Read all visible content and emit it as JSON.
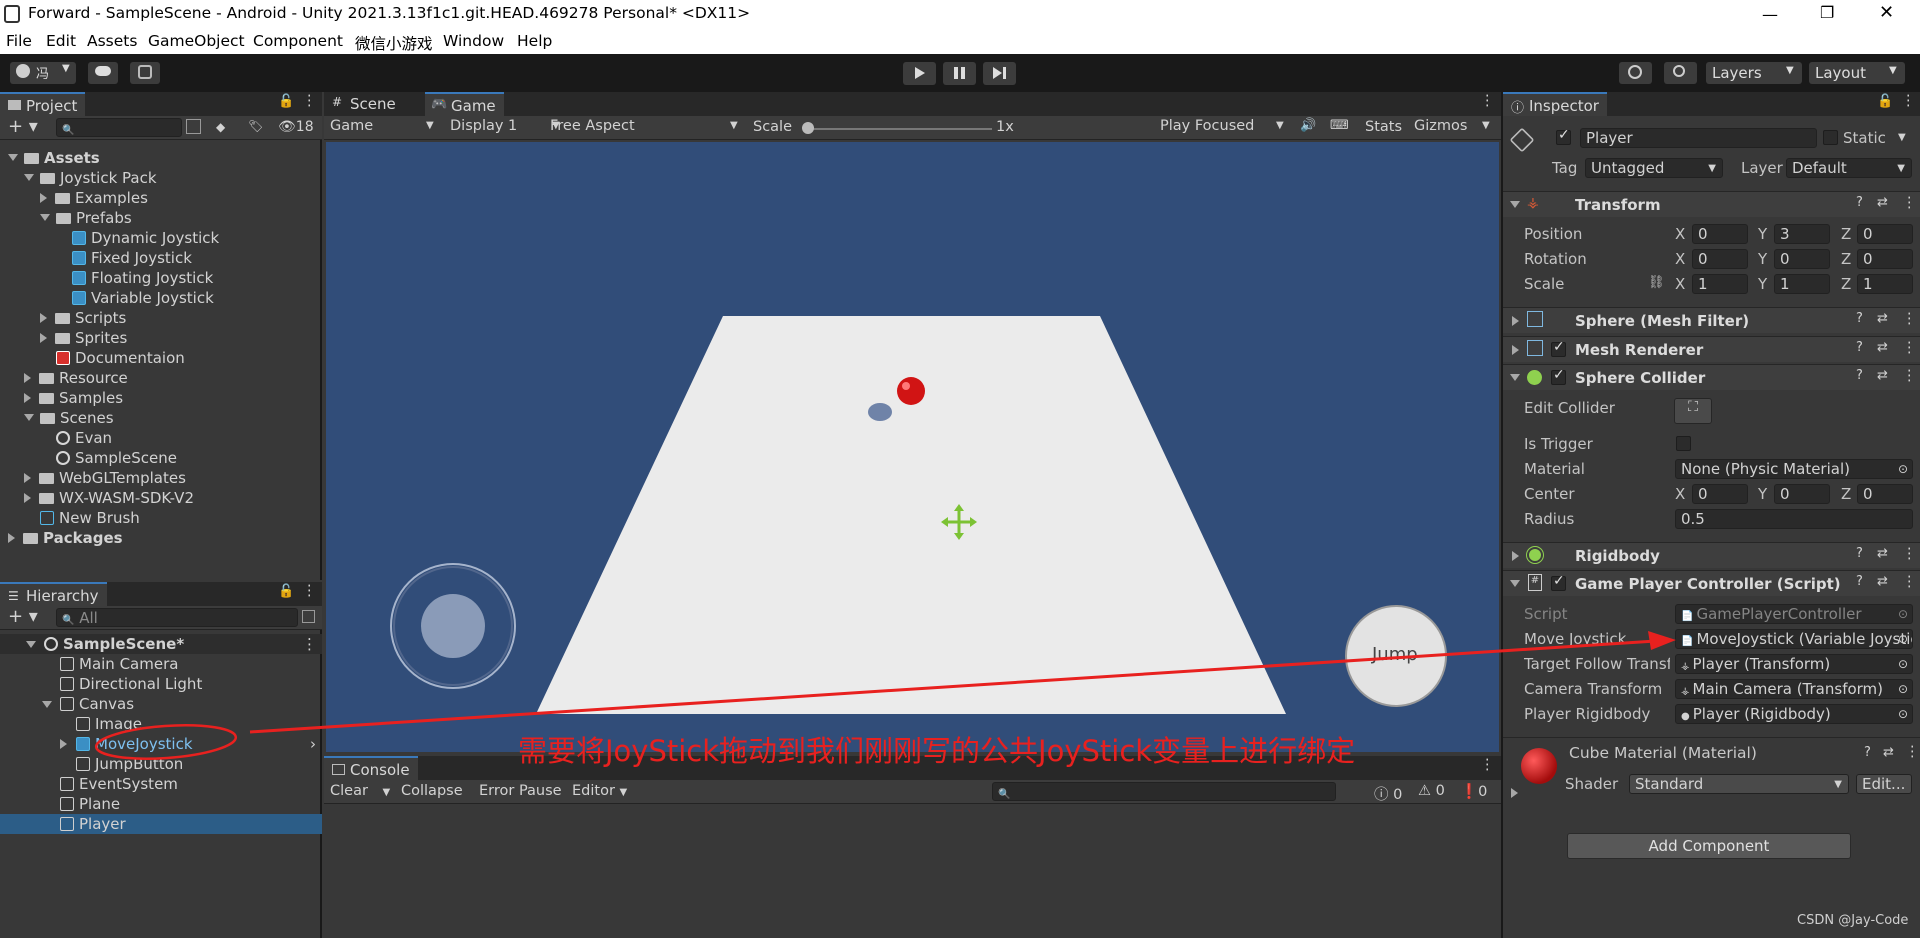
{
  "window": {
    "title": "Forward - SampleScene - Android - Unity 2021.3.13f1c1.git.HEAD.469278 Personal* <DX11>",
    "controls": [
      "—",
      "❐",
      "✕"
    ]
  },
  "menu": [
    "File",
    "Edit",
    "Assets",
    "GameObject",
    "Component",
    "微信小游戏",
    "Window",
    "Help"
  ],
  "toolbar": {
    "account": "冯",
    "layers": "Layers",
    "layout": "Layout"
  },
  "project": {
    "tab": "Project",
    "hidden_count": "18",
    "tree": [
      {
        "label": "Assets",
        "indent": 0,
        "icon": "folder",
        "expanded": true,
        "bold": true
      },
      {
        "label": "Joystick Pack",
        "indent": 1,
        "icon": "folder",
        "expanded": true
      },
      {
        "label": "Examples",
        "indent": 2,
        "icon": "folder",
        "collapsed": true
      },
      {
        "label": "Prefabs",
        "indent": 2,
        "icon": "folder",
        "expanded": true
      },
      {
        "label": "Dynamic Joystick",
        "indent": 3,
        "icon": "prefab"
      },
      {
        "label": "Fixed Joystick",
        "indent": 3,
        "icon": "prefab"
      },
      {
        "label": "Floating Joystick",
        "indent": 3,
        "icon": "prefab"
      },
      {
        "label": "Variable Joystick",
        "indent": 3,
        "icon": "prefab"
      },
      {
        "label": "Scripts",
        "indent": 2,
        "icon": "folder",
        "collapsed": true
      },
      {
        "label": "Sprites",
        "indent": 2,
        "icon": "folder",
        "collapsed": true
      },
      {
        "label": "Documentaion",
        "indent": 2,
        "icon": "pdf"
      },
      {
        "label": "Resource",
        "indent": 1,
        "icon": "folder",
        "collapsed": true
      },
      {
        "label": "Samples",
        "indent": 1,
        "icon": "folder",
        "collapsed": true
      },
      {
        "label": "Scenes",
        "indent": 1,
        "icon": "folder",
        "expanded": true
      },
      {
        "label": "Evan",
        "indent": 2,
        "icon": "scene"
      },
      {
        "label": "SampleScene",
        "indent": 2,
        "icon": "scene"
      },
      {
        "label": "WebGLTemplates",
        "indent": 1,
        "icon": "folder",
        "collapsed": true
      },
      {
        "label": "WX-WASM-SDK-V2",
        "indent": 1,
        "icon": "folder",
        "collapsed": true
      },
      {
        "label": "New Brush",
        "indent": 1,
        "icon": "brush"
      },
      {
        "label": "Packages",
        "indent": 0,
        "icon": "folder",
        "collapsed": true,
        "bold": true
      }
    ]
  },
  "hierarchy": {
    "tab": "Hierarchy",
    "search_placeholder": "All",
    "tree": [
      {
        "label": "SampleScene*",
        "indent": 0,
        "icon": "scene",
        "bold": true
      },
      {
        "label": "Main Camera",
        "indent": 1,
        "icon": "cube"
      },
      {
        "label": "Directional Light",
        "indent": 1,
        "icon": "cube"
      },
      {
        "label": "Canvas",
        "indent": 1,
        "icon": "cube",
        "expanded": true
      },
      {
        "label": "Image",
        "indent": 2,
        "icon": "cube"
      },
      {
        "label": "MoveJoystick",
        "indent": 2,
        "icon": "prefab",
        "prefab": true
      },
      {
        "label": "JumpButton",
        "indent": 2,
        "icon": "cube"
      },
      {
        "label": "EventSystem",
        "indent": 1,
        "icon": "cube"
      },
      {
        "label": "Plane",
        "indent": 1,
        "icon": "cube"
      },
      {
        "label": "Player",
        "indent": 1,
        "icon": "cube",
        "selected": true
      }
    ]
  },
  "game_view": {
    "tabs": [
      "Scene",
      "Game"
    ],
    "display_mode": "Game",
    "display": "Display 1",
    "aspect": "Free Aspect",
    "scale_label": "Scale",
    "scale_value": "1x",
    "play_mode": "Play Focused",
    "stats": "Stats",
    "gizmos": "Gizmos",
    "jump_button": "Jump"
  },
  "console": {
    "tab": "Console",
    "buttons": [
      "Clear",
      "Collapse",
      "Error Pause",
      "Editor"
    ],
    "counts": [
      "0",
      "0",
      "0"
    ]
  },
  "annotation": {
    "text": "需要将JoyStick拖动到我们刚刚写的公共JoyStick变量上进行绑定",
    "color": "#e8211f"
  },
  "inspector": {
    "tab": "Inspector",
    "object_name": "Player",
    "static_label": "Static",
    "tag_label": "Tag",
    "tag_value": "Untagged",
    "layer_label": "Layer",
    "layer_value": "Default",
    "transform": {
      "title": "Transform",
      "rows": [
        {
          "label": "Position",
          "x": "0",
          "y": "3",
          "z": "0"
        },
        {
          "label": "Rotation",
          "x": "0",
          "y": "0",
          "z": "0"
        },
        {
          "label": "Scale",
          "x": "1",
          "y": "1",
          "z": "1"
        }
      ]
    },
    "mesh_filter": "Sphere (Mesh Filter)",
    "mesh_renderer": "Mesh Renderer",
    "collider": {
      "title": "Sphere Collider",
      "edit_collider": "Edit Collider",
      "is_trigger": "Is Trigger",
      "material_label": "Material",
      "material_value": "None (Physic Material)",
      "center_label": "Center",
      "center": {
        "x": "0",
        "y": "0",
        "z": "0"
      },
      "radius_label": "Radius",
      "radius_value": "0.5"
    },
    "rigidbody": "Rigidbody",
    "script_comp": {
      "title": "Game Player Controller (Script)",
      "rows": [
        {
          "label": "Script",
          "value": "GamePlayerController",
          "dim": true
        },
        {
          "label": "Move Joystick",
          "value": "MoveJoystick (Variable Joystick)"
        },
        {
          "label": "Target Follow Transform",
          "value": "Player (Transform)"
        },
        {
          "label": "Camera Transform",
          "value": "Main Camera (Transform)"
        },
        {
          "label": "Player Rigidbody",
          "value": "Player (Rigidbody)"
        }
      ]
    },
    "material": {
      "title": "Cube Material (Material)",
      "shader_label": "Shader",
      "shader_value": "Standard",
      "edit": "Edit..."
    },
    "add_component": "Add Component"
  },
  "watermark": "CSDN @Jay-Code"
}
